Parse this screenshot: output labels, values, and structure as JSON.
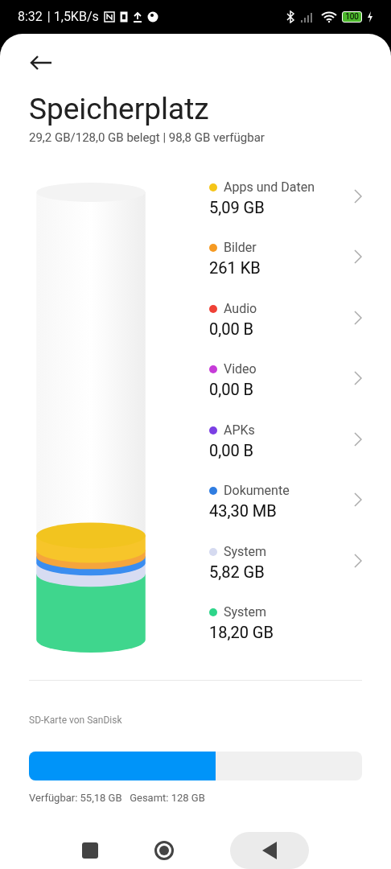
{
  "status_bar": {
    "time": "8:32",
    "speed": "| 1,5KB/s",
    "battery": "100"
  },
  "header": {
    "title": "Speicherplatz",
    "subtitle": "29,2 GB/128,0 GB belegt | 98,8 GB verfügbar"
  },
  "categories": [
    {
      "label": "Apps und Daten",
      "size": "5,09 GB",
      "color": "#f5c518",
      "chevron": true
    },
    {
      "label": "Bilder",
      "size": "261 KB",
      "color": "#f59a23",
      "chevron": true
    },
    {
      "label": "Audio",
      "size": "0,00 B",
      "color": "#ef4136",
      "chevron": true
    },
    {
      "label": "Video",
      "size": "0,00 B",
      "color": "#c63bd8",
      "chevron": true
    },
    {
      "label": "APKs",
      "size": "0,00 B",
      "color": "#7b3fe4",
      "chevron": true
    },
    {
      "label": "Dokumente",
      "size": "43,30 MB",
      "color": "#2f7de1",
      "chevron": true
    },
    {
      "label": "System",
      "size": "5,82 GB",
      "color": "#d5daf0",
      "chevron": true
    },
    {
      "label": "System",
      "size": "18,20 GB",
      "color": "#2ed58a",
      "chevron": false
    }
  ],
  "sd_card": {
    "title": "SD-Karte von SanDisk",
    "level": 0.56,
    "info": "Verfügbar: 55,18 GB   Gesamt: 128 GB"
  }
}
